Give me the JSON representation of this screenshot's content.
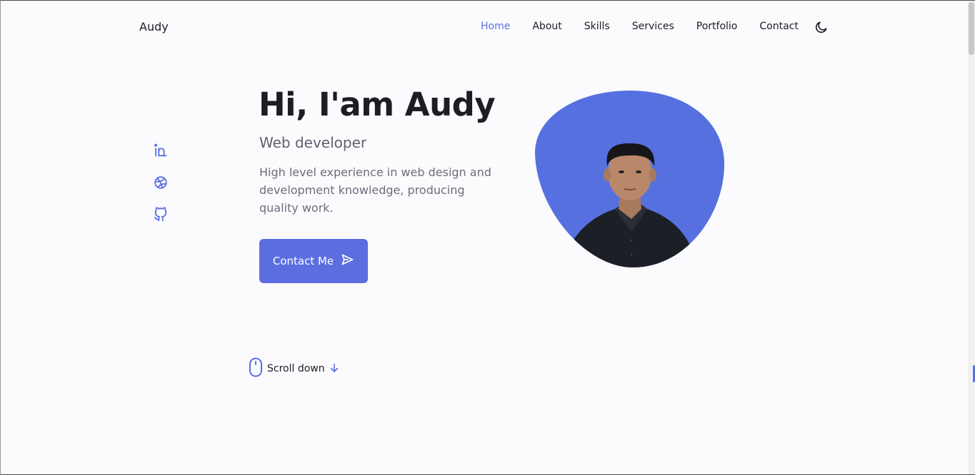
{
  "header": {
    "logo": "Audy",
    "nav": [
      {
        "label": "Home",
        "active": true
      },
      {
        "label": "About",
        "active": false
      },
      {
        "label": "Skills",
        "active": false
      },
      {
        "label": "Services",
        "active": false
      },
      {
        "label": "Portfolio",
        "active": false
      },
      {
        "label": "Contact",
        "active": false
      }
    ],
    "theme_icon": "moon-icon"
  },
  "social": {
    "icons": [
      "linkedin-icon",
      "dribbble-icon",
      "github-icon"
    ]
  },
  "hero": {
    "title": "Hi, I'am Audy",
    "subtitle": "Web developer",
    "description": "High level experience in web design and development knowledge, producing quality work.",
    "cta_label": "Contact Me",
    "cta_icon": "send-icon"
  },
  "scroll": {
    "label": "Scroll down",
    "icon": "mouse-icon",
    "arrow_icon": "arrow-down-icon"
  },
  "colors": {
    "accent": "#5a6ee0",
    "background": "#fbfbfe",
    "text": "#1d1d24",
    "muted": "#6b6e7c"
  }
}
